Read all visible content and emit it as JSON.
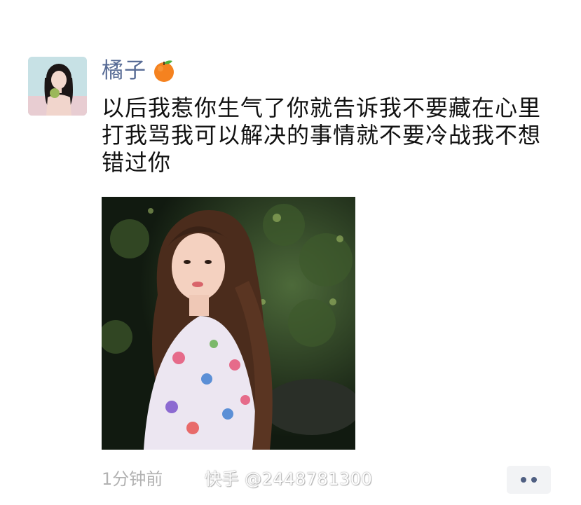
{
  "post": {
    "username": "橘子",
    "emoji_name": "tangerine-emoji",
    "text": "以后我惹你生气了你就告诉我不要藏在心里打我骂我可以解决的事情就不要冷战我不想错过你",
    "time": "1分钟前",
    "watermark": "快手 @2448781300",
    "more_icon": "more-dots-icon"
  },
  "colors": {
    "username": "#576b95",
    "text": "#111111",
    "time": "#b2b2b2",
    "more_button_bg": "#f2f3f5"
  }
}
